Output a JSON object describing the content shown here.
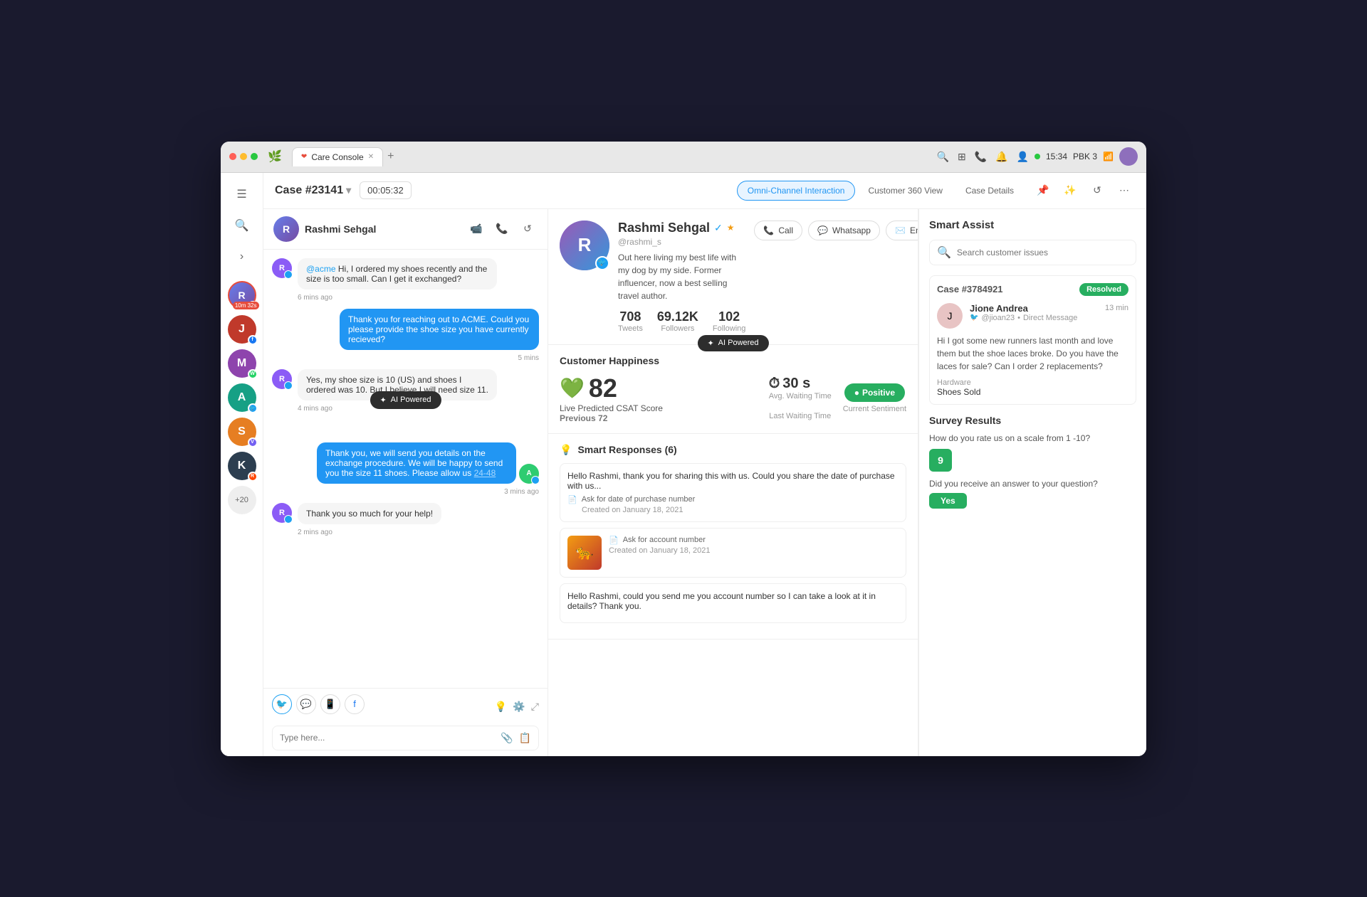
{
  "browser": {
    "tab_label": "Care Console",
    "time": "15:34",
    "pbk": "PBK 3"
  },
  "header": {
    "case_number": "Case #23141",
    "timer": "00:05:32",
    "tabs": [
      {
        "label": "Omni-Channel Interaction",
        "active": true
      },
      {
        "label": "Customer 360 View",
        "active": false
      },
      {
        "label": "Case Details",
        "active": false
      }
    ]
  },
  "chat": {
    "agent_name": "Rashmi Sehgal",
    "messages": [
      {
        "sender": "customer",
        "text": "@acme Hi, I ordered my shoes recently and the size is too small. Can I get it exchanged?",
        "time": "6 mins ago"
      },
      {
        "sender": "agent",
        "text": "Thank you for reaching out to ACME. Could you please provide the shoe size you have currently recieved?",
        "time": "5 mins"
      },
      {
        "sender": "customer",
        "text": "Yes, my shoe size is 10 (US) and shoes I ordered was 10. But I believe I will need size 11.",
        "time": "4 mins ago"
      },
      {
        "sender": "agent",
        "text": "Thank you, we will send you details on the exchange procedure. We will be happy to send you the size 11 shoes. Please allow us 24-48",
        "time": "3 mins ago"
      },
      {
        "sender": "customer",
        "text": "Thank you so much for your help!",
        "time": "2 mins ago"
      }
    ],
    "ai_powered_label": "AI Powered",
    "input_placeholder": "Type here...",
    "channel_icons": [
      "twitter",
      "chat",
      "whatsapp",
      "facebook"
    ]
  },
  "customer_profile": {
    "name": "Rashmi Sehgal",
    "handle": "@rashmi_s",
    "bio": "Out here living my best life with my dog by my side. Former influencer, now a best selling travel author.",
    "stats": {
      "tweets": "708",
      "tweets_label": "Tweets",
      "followers": "69.12K",
      "followers_label": "Followers",
      "following": "102",
      "following_label": "Following"
    },
    "action_buttons": {
      "call": "Call",
      "whatsapp": "Whatsapp",
      "email": "Email"
    }
  },
  "customer_happiness": {
    "title": "Customer Happiness",
    "csat_score": "82",
    "csat_label": "Live Predicted CSAT Score",
    "csat_previous_label": "Previous",
    "csat_previous_value": "72",
    "waiting_time": "30 s",
    "waiting_time_label": "Avg. Waiting Time",
    "last_waiting_label": "Last Waiting Time",
    "sentiment": "Positive",
    "sentiment_label": "Current Sentiment"
  },
  "smart_responses": {
    "title": "Smart Responses (6)",
    "responses": [
      {
        "text": "Hello Rashmi, thank you for sharing this with us. Could you share the date of purchase with us...",
        "action": "Ask for date of purchase number",
        "date": "Created on January 18, 2021",
        "has_image": false
      },
      {
        "text": "",
        "action": "Ask for account number",
        "date": "Created on January 18, 2021",
        "has_image": true
      },
      {
        "text": "Hello Rashmi, could you send me you account number so I can take a look at it in details? Thank you.",
        "action": "",
        "date": "",
        "has_image": false
      }
    ]
  },
  "smart_assist": {
    "title": "Smart Assist",
    "search_placeholder": "Search customer issues",
    "case_number": "Case #3784921",
    "case_status": "Resolved",
    "case_user": "Jione Andrea",
    "case_handle": "@jioan23",
    "case_channel": "Direct Message",
    "case_time": "13 min",
    "case_message": "Hi I got some new runners last month and love them but the shoe laces broke. Do you have the laces for sale? Can I order 2 replacements?",
    "case_category": "Hardware",
    "case_product": "Shoes Sold",
    "survey_title": "Survey Results",
    "survey_q1": "How do you rate us on a scale from 1 -10?",
    "survey_score": "9",
    "survey_q2": "Did you receive an answer to your question?",
    "survey_answer": "Yes"
  },
  "sidebar_avatars": [
    {
      "time": "10m 32s",
      "active": true,
      "badge": "twitter"
    },
    {
      "badge": "facebook"
    },
    {
      "badge": "whatsapp"
    },
    {
      "badge": "twitter"
    },
    {
      "badge": "viber"
    },
    {
      "badge": "reddit"
    },
    {
      "more": "+20"
    }
  ]
}
